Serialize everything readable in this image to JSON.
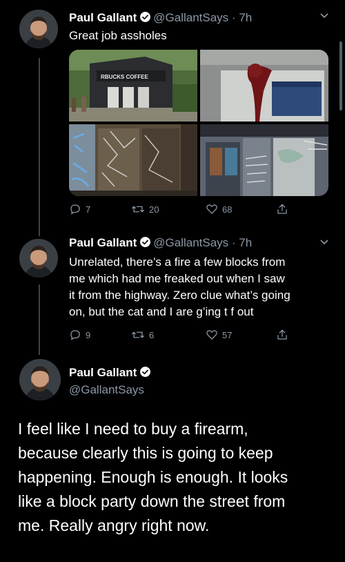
{
  "tweets": [
    {
      "name": "Paul Gallant",
      "handle": "@GallantSays",
      "time": "· 7h",
      "text": "Great job assholes",
      "media_sign": "RBUCKS COFFEE",
      "counts": {
        "replies": "7",
        "retweets": "20",
        "likes": "68"
      }
    },
    {
      "name": "Paul Gallant",
      "handle": "@GallantSays",
      "time": "· 7h",
      "text_lines": [
        "Unrelated, there’s a fire a few blocks from",
        "me which had me freaked out when I saw",
        "it from the highway. Zero clue what’s going",
        "on, but the cat and I are g’ing t f out"
      ],
      "counts": {
        "replies": "9",
        "retweets": "6",
        "likes": "57"
      }
    }
  ],
  "main_tweet": {
    "name": "Paul Gallant",
    "handle": "@GallantSays",
    "text_lines": [
      "I feel like I need to buy a firearm,",
      "because clearly this is going to keep",
      "happening. Enough is enough. It looks",
      "like a block party down the street from",
      "me. Really angry right now."
    ]
  },
  "icons": [
    "verified-badge-icon",
    "chevron-down-icon",
    "reply-icon",
    "retweet-icon",
    "like-icon",
    "share-icon"
  ],
  "colors": {
    "background": "#000000",
    "secondary_text": "#8b98a5",
    "thread_line": "#38444d"
  }
}
